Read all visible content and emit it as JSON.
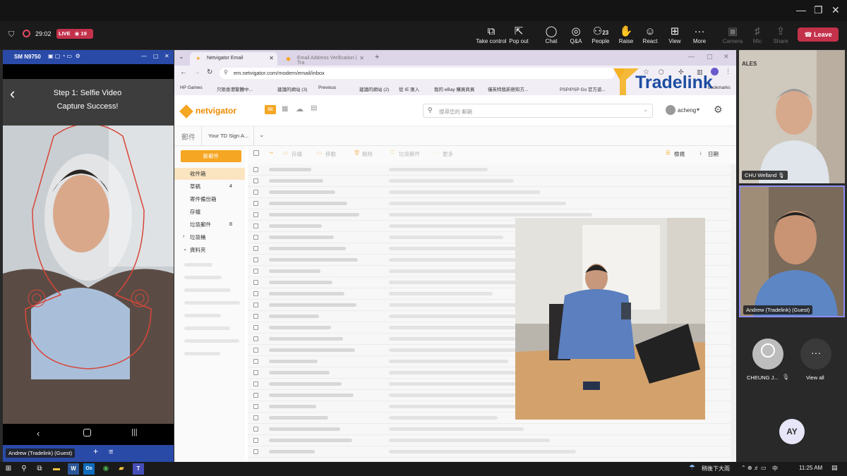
{
  "meeting": {
    "timer": "29:02",
    "live_label": "LIVE",
    "viewers": "19",
    "toolbar": [
      {
        "label": "Take control",
        "icon": "take-control-icon",
        "glyph": "⧉",
        "badge": "",
        "disabled": false
      },
      {
        "label": "Pop out",
        "icon": "pop-out-icon",
        "glyph": "⇱",
        "badge": "",
        "disabled": false
      },
      {
        "label": "Chat",
        "icon": "chat-icon",
        "glyph": "◯",
        "badge": "",
        "disabled": false
      },
      {
        "label": "Q&A",
        "icon": "qa-icon",
        "glyph": "◎",
        "badge": "",
        "disabled": false
      },
      {
        "label": "People",
        "icon": "people-icon",
        "glyph": "⚇",
        "badge": "23",
        "disabled": false
      },
      {
        "label": "Raise",
        "icon": "raise-hand-icon",
        "glyph": "✋",
        "badge": "",
        "disabled": false
      },
      {
        "label": "React",
        "icon": "react-icon",
        "glyph": "☺",
        "badge": "",
        "disabled": false
      },
      {
        "label": "View",
        "icon": "view-icon",
        "glyph": "⊞",
        "badge": "",
        "disabled": false
      },
      {
        "label": "More",
        "icon": "more-icon",
        "glyph": "···",
        "badge": "",
        "disabled": false
      },
      {
        "label": "Camera",
        "icon": "camera-icon",
        "glyph": "▣",
        "badge": "",
        "disabled": true
      },
      {
        "label": "Mic",
        "icon": "mic-icon",
        "glyph": "♯",
        "badge": "",
        "disabled": true
      },
      {
        "label": "Share",
        "icon": "share-icon",
        "glyph": "⇪",
        "badge": "",
        "disabled": true
      }
    ],
    "leave_label": "Leave"
  },
  "phone": {
    "device_name": "SM N9750",
    "step_title": "Step 1: Selfie Video",
    "step_status": "Capture Success!",
    "presenter_chip": "Andrew (Tradelink) (Guest)"
  },
  "browser": {
    "tabs": [
      {
        "title": "Netvigator Email",
        "active": true
      },
      {
        "title": "Email Address Verification | Tra",
        "active": false
      }
    ],
    "url": "em.netvigator.com/modern/email/inbox",
    "bookmarks": [
      "HP Games",
      "只限香港繁體中...",
      "建議的網站 (3)",
      "Previous",
      "建議的網站 (2)",
      "從 IE 匯入",
      "我的 eBay 購買商買",
      "僅英特我新懸知方...",
      "PSP/PSP Go 官方遊..."
    ],
    "bookmarks_right": "bookmarks"
  },
  "tradelink_logo": "Tradelink",
  "netvigator": {
    "logo": "netvigator",
    "search_placeholder": "搜尋您的 郵箱",
    "user": "acheng",
    "folder_title": "郵件",
    "signature_select": "Your TD Sign A...",
    "compose": "新郵件",
    "folders": [
      {
        "label": "收件箱",
        "count": "",
        "active": true
      },
      {
        "label": "草稿",
        "count": "4",
        "active": false
      },
      {
        "label": "寄件備份箱",
        "count": "",
        "active": false
      },
      {
        "label": "存檔",
        "count": "",
        "active": false
      },
      {
        "label": "垃圾郵件",
        "count": "8",
        "active": false
      },
      {
        "label": "垃圾桶",
        "count": "",
        "active": false
      },
      {
        "label": "資料夾",
        "count": "",
        "active": false
      }
    ],
    "actions": [
      "存檔",
      "移動",
      "刪除",
      "垃圾郵件",
      "更多"
    ],
    "view_label": "檢視",
    "sort_label": "日期"
  },
  "participants": [
    {
      "name": "CHU Welland"
    },
    {
      "name": "Andrew (Tradelink) (Guest)"
    },
    {
      "name": "CHEUNG J...",
      "initials": ""
    }
  ],
  "view_all_label": "View all",
  "self_initials": "AY",
  "taskbar": {
    "weather": "稍後下大雨",
    "ime": "中",
    "time": "11:25 AM"
  },
  "colors": {
    "leave": "#c4314b",
    "accent_blue": "#2a4aa8",
    "netvigator_orange": "#f5a623"
  }
}
